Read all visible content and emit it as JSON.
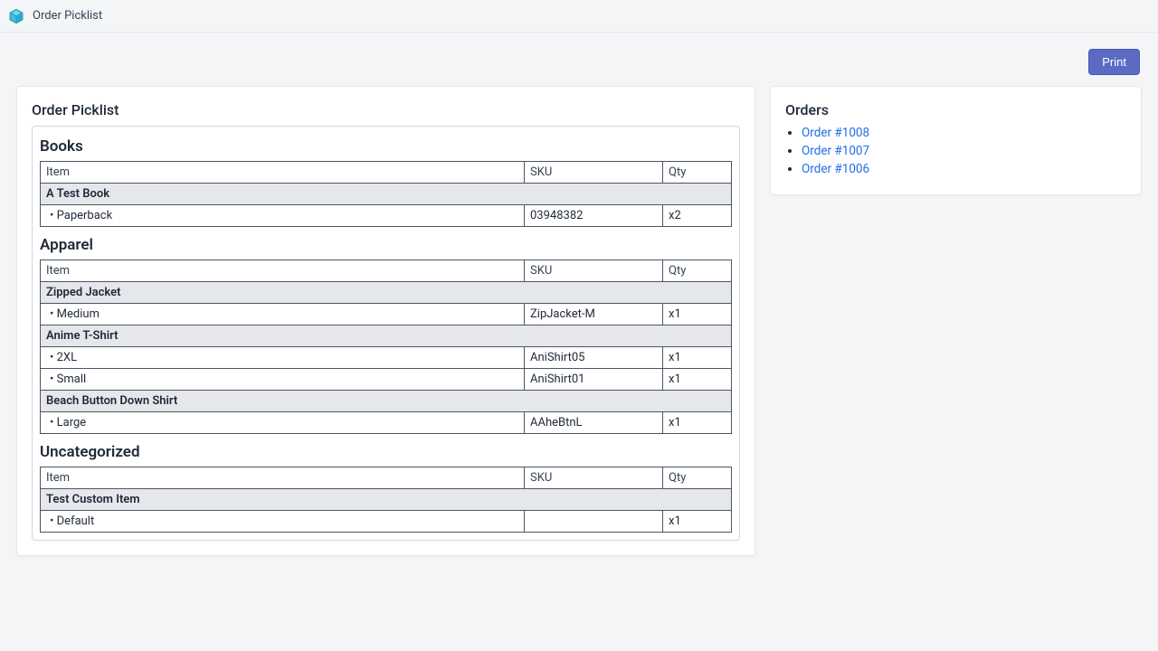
{
  "app": {
    "title": "Order Picklist"
  },
  "actions": {
    "print": "Print"
  },
  "main": {
    "title": "Order Picklist",
    "headers": {
      "item": "Item",
      "sku": "SKU",
      "qty": "Qty"
    },
    "categories": [
      {
        "name": "Books",
        "groups": [
          {
            "name": "A Test Book",
            "rows": [
              {
                "variant": "Paperback",
                "sku": "03948382",
                "qty": "x2"
              }
            ]
          }
        ]
      },
      {
        "name": "Apparel",
        "groups": [
          {
            "name": "Zipped Jacket",
            "rows": [
              {
                "variant": "Medium",
                "sku": "ZipJacket-M",
                "qty": "x1"
              }
            ]
          },
          {
            "name": "Anime T-Shirt",
            "rows": [
              {
                "variant": "2XL",
                "sku": "AniShirt05",
                "qty": "x1"
              },
              {
                "variant": "Small",
                "sku": "AniShirt01",
                "qty": "x1"
              }
            ]
          },
          {
            "name": "Beach Button Down Shirt",
            "rows": [
              {
                "variant": "Large",
                "sku": "AAheBtnL",
                "qty": "x1"
              }
            ]
          }
        ]
      },
      {
        "name": "Uncategorized",
        "groups": [
          {
            "name": "Test Custom Item",
            "rows": [
              {
                "variant": "Default",
                "sku": "",
                "qty": "x1"
              }
            ]
          }
        ]
      }
    ]
  },
  "side": {
    "title": "Orders",
    "orders": [
      {
        "label": "Order #1008"
      },
      {
        "label": "Order #1007"
      },
      {
        "label": "Order #1006"
      }
    ]
  }
}
